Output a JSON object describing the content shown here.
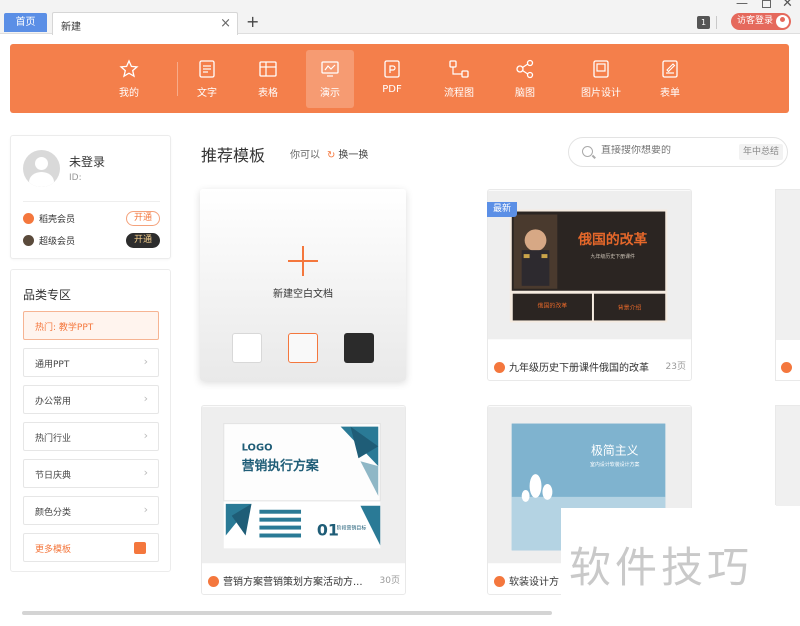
{
  "tabs": {
    "home": "首页",
    "current": "新建",
    "close": "×",
    "add": "+"
  },
  "window": {
    "badge": "1",
    "login_label": "访客登录"
  },
  "toolbar": {
    "items": [
      {
        "label": "我的",
        "icon": "star-icon"
      },
      {
        "label": "文字",
        "icon": "document-icon"
      },
      {
        "label": "表格",
        "icon": "table-icon"
      },
      {
        "label": "演示",
        "icon": "presentation-icon",
        "active": true
      },
      {
        "label": "PDF",
        "icon": "pdf-icon"
      },
      {
        "label": "流程图",
        "icon": "flowchart-icon"
      },
      {
        "label": "脑图",
        "icon": "mindmap-icon"
      },
      {
        "label": "图片设计",
        "icon": "image-design-icon"
      },
      {
        "label": "表单",
        "icon": "form-icon"
      }
    ],
    "accent": "#f47f4b"
  },
  "user": {
    "name": "未登录",
    "id_label": "ID:",
    "members": [
      {
        "label": "稻壳会员",
        "button": "开通"
      },
      {
        "label": "超级会员",
        "button": "开通"
      }
    ]
  },
  "categories": {
    "title": "品类专区",
    "items": [
      "热门: 教学PPT",
      "通用PPT",
      "办公常用",
      "热门行业",
      "节日庆典",
      "颜色分类",
      "更多模板"
    ],
    "chevron": "›"
  },
  "main": {
    "title": "推荐模板",
    "hint": "你可以",
    "refresh": "换一换",
    "search_placeholder": "直接搜你想要的",
    "search_tag": "年中总结",
    "new_blank": "新建空白文档",
    "new_tag": "最新"
  },
  "templates": [
    {
      "title": "九年级历史下册课件俄国的改革",
      "pages": "23页",
      "thumb_heading": "俄国的改革",
      "thumb_sub": "九年级历史下册课件",
      "thumb_box1": "俄国的改革",
      "thumb_box2": "背景介绍"
    },
    {
      "title": "营销方案营销策划方案活动方...",
      "pages": "30页",
      "thumb_logo": "LOGO",
      "thumb_heading": "营销执行方案",
      "thumb_section": "01",
      "thumb_section_label": "阶段营销目标"
    },
    {
      "title": "软装设计方",
      "pages": "",
      "thumb_heading": "极简主义",
      "thumb_sub": "室内设计软装设计方案"
    }
  ],
  "watermark": "软件技巧"
}
